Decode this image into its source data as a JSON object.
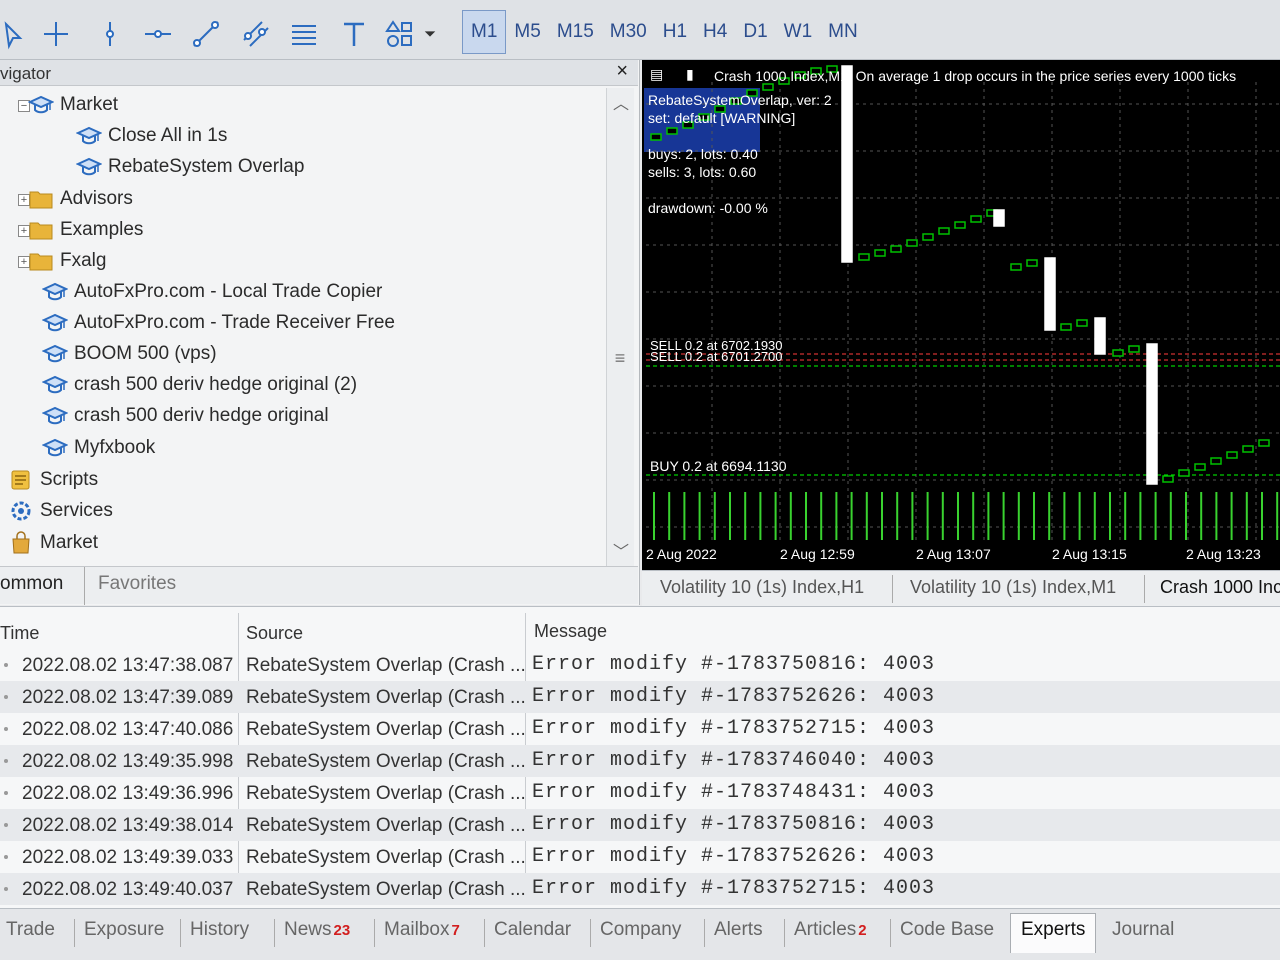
{
  "toolbar": {
    "tools": [
      "cursor-icon",
      "crosshair-icon",
      "vertical-line-icon",
      "horizontal-line-icon",
      "trendline-icon",
      "equidistant-channel-icon",
      "fibonacci-icon",
      "text-icon",
      "shapes-icon"
    ],
    "timeframes": [
      "M1",
      "M5",
      "M15",
      "M30",
      "H1",
      "H4",
      "D1",
      "W1",
      "MN"
    ],
    "active_timeframe": "M1"
  },
  "navigator": {
    "title": "vigator",
    "close": "×",
    "items": [
      {
        "label": "Market",
        "icon": "cap-icon"
      },
      {
        "label": "Close All in 1s",
        "icon": "cap-icon"
      },
      {
        "label": "RebateSystem Overlap",
        "icon": "cap-icon"
      },
      {
        "label": "Advisors",
        "icon": "folder-icon"
      },
      {
        "label": "Examples",
        "icon": "folder-icon"
      },
      {
        "label": "Fxalg",
        "icon": "folder-icon"
      },
      {
        "label": "AutoFxPro.com - Local Trade Copier",
        "icon": "cap-icon"
      },
      {
        "label": "AutoFxPro.com - Trade Receiver Free",
        "icon": "cap-icon"
      },
      {
        "label": "BOOM 500 (vps)",
        "icon": "cap-icon"
      },
      {
        "label": "crash 500 deriv hedge original (2)",
        "icon": "cap-icon"
      },
      {
        "label": "crash 500 deriv hedge original",
        "icon": "cap-icon"
      },
      {
        "label": "Myfxbook",
        "icon": "cap-icon"
      },
      {
        "label": "Scripts",
        "icon": "scripts-icon"
      },
      {
        "label": "Services",
        "icon": "services-icon"
      },
      {
        "label": "Market",
        "icon": "bag-icon"
      }
    ],
    "tabs": {
      "common": "ommon",
      "favorites": "Favorites"
    }
  },
  "chart": {
    "header": "Crash 1000 Index,M1:  On average 1 drop occurs in the price series every 1000 ticks",
    "ea_name": "RebateSystemOverlap, ver: 2",
    "set_line": "set: default [WARNING]",
    "buys": "buys:  2, lots: 0.40",
    "sells": "sells: 3, lots: 0.60",
    "drawdown": "drawdown: -0.00 %",
    "sell_line_1": "SELL 0.2 at 6702.1930",
    "sell_line_2": "SELL 0.2 at 6701.2700",
    "buy_line": "BUY 0.2 at 6694.1130",
    "time_labels": [
      "2 Aug 2022",
      "2 Aug 12:59",
      "2 Aug 13:07",
      "2 Aug 13:15",
      "2 Aug 13:23"
    ],
    "colors": {
      "bg": "#000000",
      "bull": "#00c000",
      "bear": "#ffffff",
      "sell": "#ff3b3b",
      "buy": "#00ff00",
      "volume": "#39d22f"
    }
  },
  "chart_tabs": [
    "Volatility 10 (1s) Index,H1",
    "Volatility 10 (1s) Index,M1",
    "Crash 1000 Inc"
  ],
  "log": {
    "headers": {
      "time": "Time",
      "source": "Source",
      "message": "Message"
    },
    "rows": [
      {
        "time": "2022.08.02 13:47:38.087",
        "source": "RebateSystem Overlap (Crash ...",
        "message": "Error modify #-1783750816: 4003"
      },
      {
        "time": "2022.08.02 13:47:39.089",
        "source": "RebateSystem Overlap (Crash ...",
        "message": "Error modify #-1783752626: 4003"
      },
      {
        "time": "2022.08.02 13:47:40.086",
        "source": "RebateSystem Overlap (Crash ...",
        "message": "Error modify #-1783752715: 4003"
      },
      {
        "time": "2022.08.02 13:49:35.998",
        "source": "RebateSystem Overlap (Crash ...",
        "message": "Error modify #-1783746040: 4003"
      },
      {
        "time": "2022.08.02 13:49:36.996",
        "source": "RebateSystem Overlap (Crash ...",
        "message": "Error modify #-1783748431: 4003"
      },
      {
        "time": "2022.08.02 13:49:38.014",
        "source": "RebateSystem Overlap (Crash ...",
        "message": "Error modify #-1783750816: 4003"
      },
      {
        "time": "2022.08.02 13:49:39.033",
        "source": "RebateSystem Overlap (Crash ...",
        "message": "Error modify #-1783752626: 4003"
      },
      {
        "time": "2022.08.02 13:49:40.037",
        "source": "RebateSystem Overlap (Crash ...",
        "message": "Error modify #-1783752715: 4003"
      }
    ]
  },
  "bottom_tabs": [
    {
      "label": "Trade",
      "badge": ""
    },
    {
      "label": "Exposure",
      "badge": ""
    },
    {
      "label": "History",
      "badge": ""
    },
    {
      "label": "News",
      "badge": "23"
    },
    {
      "label": "Mailbox",
      "badge": "7"
    },
    {
      "label": "Calendar",
      "badge": ""
    },
    {
      "label": "Company",
      "badge": ""
    },
    {
      "label": "Alerts",
      "badge": ""
    },
    {
      "label": "Articles",
      "badge": "2"
    },
    {
      "label": "Code Base",
      "badge": ""
    },
    {
      "label": "Experts",
      "badge": ""
    },
    {
      "label": "Journal",
      "badge": ""
    }
  ],
  "active_bottom_tab": "Experts"
}
